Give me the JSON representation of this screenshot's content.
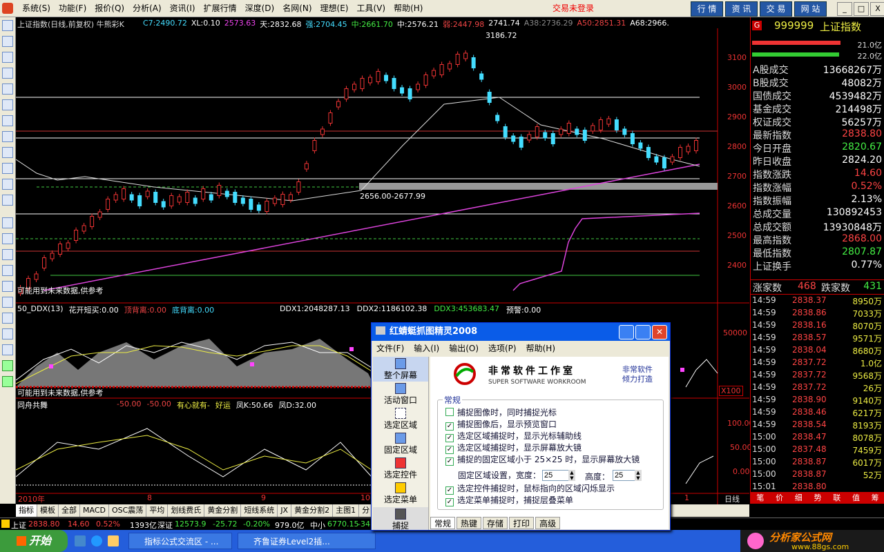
{
  "menubar": {
    "items": [
      "系统(S)",
      "功能(F)",
      "报价(Q)",
      "分析(A)",
      "资讯(I)",
      "扩展行情",
      "深度(D)",
      "名网(N)",
      "理想(E)",
      "工具(V)",
      "帮助(H)"
    ],
    "login_status": "交易未登录",
    "buttons": [
      "行 情",
      "资 讯",
      "交 易",
      "网 站"
    ],
    "window_controls": [
      "_",
      "□",
      "X"
    ]
  },
  "chart": {
    "title": "上证指数(日线,前复权) 牛熊彩K",
    "indicators": [
      {
        "label": "C7:2490.72",
        "color": "#4df"
      },
      {
        "label": "XL:0.10",
        "color": "#fff"
      },
      {
        "label": "2573.63",
        "color": "#e4e"
      },
      {
        "label": "天:2832.68",
        "color": "#fff"
      },
      {
        "label": "强:2704.45",
        "color": "#4df"
      },
      {
        "label": "中:2661.70",
        "color": "#4e4"
      },
      {
        "label": "中:2576.21",
        "color": "#fff"
      },
      {
        "label": "弱:2447.98",
        "color": "#e44"
      },
      {
        "label": "2741.74",
        "color": "#fff"
      },
      {
        "label": "A38:2736.29",
        "color": "#888"
      },
      {
        "label": "A50:2851.31",
        "color": "#e44"
      },
      {
        "label": "A68:2966.",
        "color": "#fff"
      }
    ],
    "peak_label": "3186.72",
    "box_label": "2656.00-2677.99",
    "note1": "可能用到未来数据,供参考",
    "y_ticks": [
      "3100",
      "3000",
      "2900",
      "2800",
      "2700",
      "2600",
      "2500",
      "2400"
    ],
    "ddx_header": {
      "name": "50_DDX(13)",
      "items": [
        {
          "label": "花开短买:0.00",
          "color": "#fff"
        },
        {
          "label": "顶背离:0.00",
          "color": "#e44"
        },
        {
          "label": "底背离:0.00",
          "color": "#4df"
        },
        {
          "label": "DDX1:2048287.13",
          "color": "#fff"
        },
        {
          "label": "DDX2:1186102.38",
          "color": "#fff"
        },
        {
          "label": "DDX3:453683.47",
          "color": "#4e4"
        },
        {
          "label": "预警:0.00",
          "color": "#fff"
        }
      ],
      "y_tick": "50000",
      "scale": "X100"
    },
    "note2": "可能用到未来数据,供参考",
    "sub3": {
      "name": "同舟共舞",
      "items": [
        {
          "label": "-50.00",
          "color": "#e44"
        },
        {
          "label": "-50.00",
          "color": "#e44"
        },
        {
          "label": "有心就有-",
          "color": "#ee4"
        },
        {
          "label": "好运",
          "color": "#ee4"
        },
        {
          "label": "凤K:50.66",
          "color": "#fff"
        },
        {
          "label": "凤D:32.00",
          "color": "#fff"
        }
      ],
      "y_ticks": [
        "100.00",
        "50.00",
        "0.00"
      ]
    },
    "x_labels": [
      "2010年",
      "8",
      "9",
      "10",
      "1"
    ],
    "x_period": "日线"
  },
  "right_panel": {
    "code": "999999",
    "name": "上证指数",
    "bar1": "21.0亿",
    "bar2": "22.0亿",
    "stats": [
      {
        "k": "A股成交",
        "v": "13668267万",
        "c": "#fff"
      },
      {
        "k": "B股成交",
        "v": "48082万",
        "c": "#fff"
      },
      {
        "k": "国债成交",
        "v": "4539482万",
        "c": "#fff"
      },
      {
        "k": "基金成交",
        "v": "214498万",
        "c": "#fff"
      },
      {
        "k": "权证成交",
        "v": "56257万",
        "c": "#fff"
      },
      {
        "k": "最新指数",
        "v": "2838.80",
        "c": "#f44"
      },
      {
        "k": "今日开盘",
        "v": "2820.67",
        "c": "#4e4"
      },
      {
        "k": "昨日收盘",
        "v": "2824.20",
        "c": "#fff"
      },
      {
        "k": "指数涨跌",
        "v": "14.60",
        "c": "#f44"
      },
      {
        "k": "指数涨幅",
        "v": "0.52%",
        "c": "#f44"
      },
      {
        "k": "指数振幅",
        "v": "2.13%",
        "c": "#fff"
      },
      {
        "k": "总成交量",
        "v": "130892453",
        "c": "#fff"
      },
      {
        "k": "总成交额",
        "v": "13930848万",
        "c": "#fff"
      },
      {
        "k": "最高指数",
        "v": "2868.00",
        "c": "#f44"
      },
      {
        "k": "最低指数",
        "v": "2807.87",
        "c": "#4e4"
      },
      {
        "k": "上证换手",
        "v": "0.77%",
        "c": "#fff"
      }
    ],
    "up_label": "涨家数",
    "up_count": "468",
    "down_label": "跌家数",
    "down_count": "431",
    "ticks": [
      {
        "t": "14:59",
        "p": "2838.37",
        "v": "8950万",
        "c": "#f44"
      },
      {
        "t": "14:59",
        "p": "2838.86",
        "v": "7033万",
        "c": "#f44"
      },
      {
        "t": "14:59",
        "p": "2838.16",
        "v": "8070万",
        "c": "#f44"
      },
      {
        "t": "14:59",
        "p": "2838.57",
        "v": "9571万",
        "c": "#f44"
      },
      {
        "t": "14:59",
        "p": "2838.04",
        "v": "8680万",
        "c": "#f44"
      },
      {
        "t": "14:59",
        "p": "2837.72",
        "v": "1.0亿",
        "c": "#f44"
      },
      {
        "t": "14:59",
        "p": "2837.72",
        "v": "9568万",
        "c": "#f44"
      },
      {
        "t": "14:59",
        "p": "2837.72",
        "v": "26万",
        "c": "#f44"
      },
      {
        "t": "14:59",
        "p": "2838.90",
        "v": "9140万",
        "c": "#f44"
      },
      {
        "t": "14:59",
        "p": "2838.46",
        "v": "6217万",
        "c": "#f44"
      },
      {
        "t": "14:59",
        "p": "2838.54",
        "v": "8193万",
        "c": "#f44"
      },
      {
        "t": "15:00",
        "p": "2838.47",
        "v": "8078万",
        "c": "#f44"
      },
      {
        "t": "15:00",
        "p": "2837.48",
        "v": "7459万",
        "c": "#f44"
      },
      {
        "t": "15:00",
        "p": "2838.87",
        "v": "6017万",
        "c": "#f44"
      },
      {
        "t": "15:00",
        "p": "2838.87",
        "v": "52万",
        "c": "#f44"
      },
      {
        "t": "15:01",
        "p": "2838.80",
        "v": "",
        "c": "#f44"
      }
    ],
    "bottom_tabs": [
      "笔",
      "价",
      "细",
      "势",
      "联",
      "值",
      "筹"
    ]
  },
  "bottom_tabs": [
    "指标",
    "模板",
    "全部",
    "MACD",
    "OSC震荡",
    "平均",
    "划线费氏",
    "黄金分割",
    "短线系统",
    "JX",
    "黄金分割2",
    "主图1",
    "分"
  ],
  "status_bar": {
    "sh_label": "上证",
    "sh_price": "2838.80",
    "sh_change": "14.60",
    "sh_pct": "0.52%",
    "sh_amount": "1393亿",
    "sz_label": "深证",
    "sz_price": "12573.9",
    "sz_change": "-25.72",
    "sz_pct": "-0.20%",
    "sz_amount": "979.0亿",
    "zx_label": "中小",
    "zx_price": "6770.15",
    "zx_change": "-34"
  },
  "taskbar": {
    "start": "开始",
    "tasks": [
      "指标公式交流区 - ...",
      "齐鲁证券Level2插..."
    ],
    "watermark": "分析家公式网",
    "watermark_url": "www.88gs.com"
  },
  "dialog": {
    "title": "红蜻蜓抓图精灵2008",
    "menu": [
      "文件(F)",
      "输入(I)",
      "输出(O)",
      "选项(P)",
      "帮助(H)"
    ],
    "sidebar": [
      "整个屏幕",
      "活动窗口",
      "选定区域",
      "固定区域",
      "选定控件",
      "选定菜单",
      "捕捉"
    ],
    "brand_cn": "非常软件工作室",
    "brand_en": "SUPER SOFTWARE WORKROOM",
    "slogan1": "非常软件",
    "slogan2": "倾力打造",
    "section": "常规",
    "options": [
      {
        "label": "捕捉图像时，同时捕捉光标",
        "checked": false
      },
      {
        "label": "捕捉图像后，显示预览窗口",
        "checked": true
      },
      {
        "label": "选定区域捕捉时，显示光标辅助线",
        "checked": true
      },
      {
        "label": "选定区域捕捉时，显示屏幕放大镜",
        "checked": true
      },
      {
        "label": "捕捉的固定区域小于 25×25 时，显示屏幕放大镜",
        "checked": true
      }
    ],
    "fixed_label": "固定区域设置，宽度：",
    "fixed_width": "25",
    "height_label": "高度：",
    "fixed_height": "25",
    "options2": [
      {
        "label": "选定控件捕捉时，鼠标指向的区域闪烁显示",
        "checked": true
      },
      {
        "label": "选定菜单捕捉时，捕捉层叠菜单",
        "checked": true
      }
    ],
    "tabs": [
      "常规",
      "热键",
      "存储",
      "打印",
      "高级"
    ]
  }
}
